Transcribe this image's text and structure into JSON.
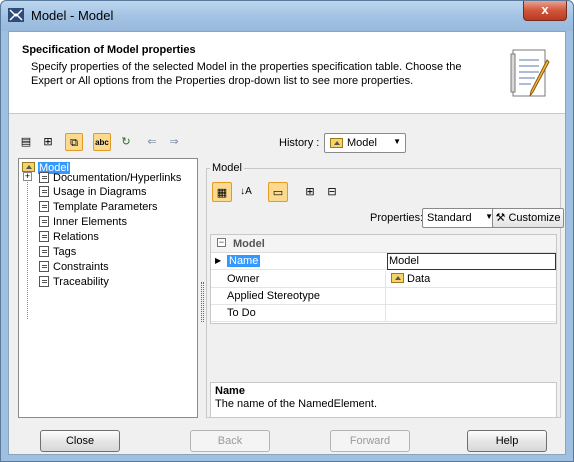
{
  "window": {
    "title": "Model - Model",
    "close_glyph": "x"
  },
  "header": {
    "title": "Specification of Model properties",
    "description": "Specify properties of the selected Model in the properties specification table. Choose the Expert or All options from the Properties drop-down list to see more properties."
  },
  "toolbar": {
    "history_label": "History :",
    "history_value": "Model"
  },
  "tree": {
    "root": "Model",
    "items": [
      "Documentation/Hyperlinks",
      "Usage in Diagrams",
      "Template Parameters",
      "Inner Elements",
      "Relations",
      "Tags",
      "Constraints",
      "Traceability"
    ]
  },
  "panel": {
    "group_label": "Model",
    "properties_label": "Properties:",
    "properties_value": "Standard",
    "customize_label": "Customize",
    "grid_caption": "Model",
    "rows": [
      {
        "name": "Name",
        "value": "Model"
      },
      {
        "name": "Owner",
        "value": "Data"
      },
      {
        "name": "Applied Stereotype",
        "value": ""
      },
      {
        "name": "To Do",
        "value": ""
      }
    ],
    "desc_title": "Name",
    "desc_text": "The name of the NamedElement."
  },
  "buttons": {
    "close": "Close",
    "back": "Back",
    "forward": "Forward",
    "help": "Help"
  },
  "colors": {
    "selection": "#3399ff",
    "toggle_active": "#fbd98e"
  }
}
